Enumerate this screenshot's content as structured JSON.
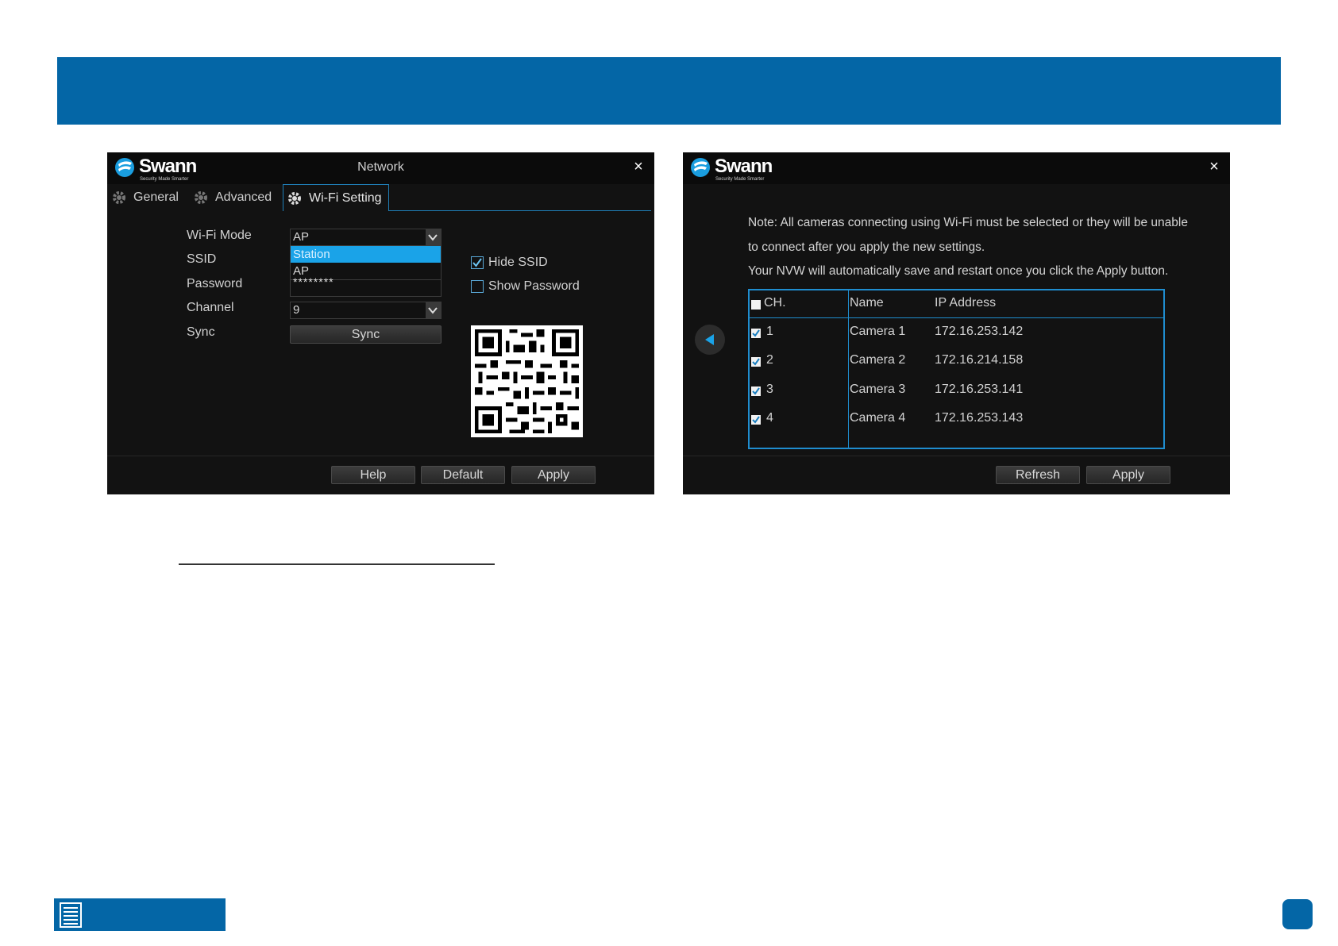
{
  "colors": {
    "banner": "#0466a6",
    "accent": "#1aa3e8",
    "panel_bg": "#121212"
  },
  "left_window": {
    "logo_word": "Swann",
    "logo_tagline": "Security Made Smarter",
    "title": "Network",
    "close_glyph": "×",
    "tabs": [
      {
        "label": "General",
        "icon": "gear-icon"
      },
      {
        "label": "Advanced",
        "icon": "gear-icon"
      },
      {
        "label": "Wi-Fi Setting",
        "icon": "gear-icon",
        "active": true
      }
    ],
    "fields": {
      "wifi_mode_label": "Wi-Fi Mode",
      "wifi_mode_value": "AP",
      "wifi_mode_options": [
        "Station",
        "AP"
      ],
      "wifi_mode_highlighted": "Station",
      "ssid_label": "SSID",
      "password_label": "Password",
      "password_value": "********",
      "channel_label": "Channel",
      "channel_value": "9",
      "sync_label": "Sync",
      "sync_button": "Sync"
    },
    "checkboxes": [
      {
        "label": "Hide SSID",
        "checked": true
      },
      {
        "label": "Show Password",
        "checked": false
      }
    ],
    "buttons": {
      "help": "Help",
      "default": "Default",
      "apply": "Apply"
    }
  },
  "right_window": {
    "logo_word": "Swann",
    "logo_tagline": "Security Made Smarter",
    "close_glyph": "×",
    "note_lines": [
      "Note: All cameras connecting using Wi-Fi must be selected or they will be unable",
      "to connect after you apply the new settings.",
      "Your NVW will automatically save and restart once you click the Apply button."
    ],
    "table": {
      "headers": {
        "ch": "CH.",
        "name": "Name",
        "ip": "IP Address"
      },
      "rows": [
        {
          "ch": "1",
          "name": "Camera 1",
          "ip": "172.16.253.142",
          "checked": true
        },
        {
          "ch": "2",
          "name": "Camera 2",
          "ip": "172.16.214.158",
          "checked": true
        },
        {
          "ch": "3",
          "name": "Camera 3",
          "ip": "172.16.253.141",
          "checked": true
        },
        {
          "ch": "4",
          "name": "Camera 4",
          "ip": "172.16.253.143",
          "checked": true
        }
      ]
    },
    "buttons": {
      "refresh": "Refresh",
      "apply": "Apply"
    }
  }
}
